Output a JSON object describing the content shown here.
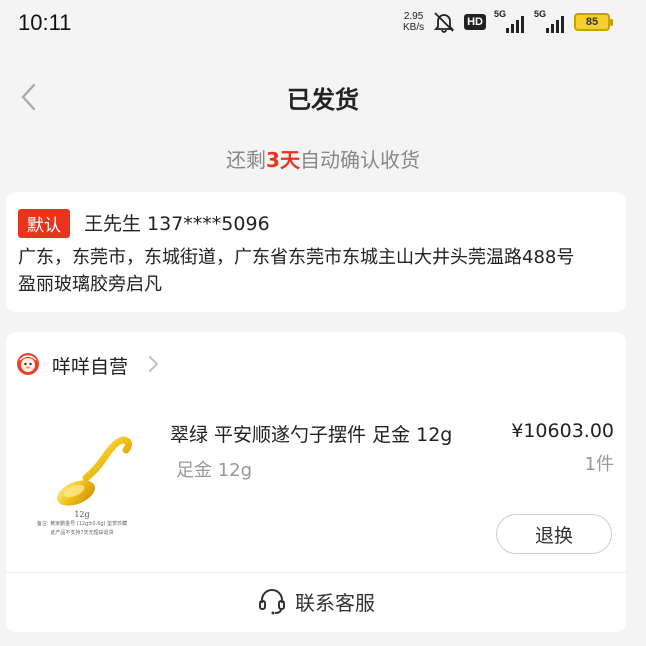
{
  "status_bar": {
    "time": "10:11",
    "speed_value": "2.95",
    "speed_unit": "KB/s",
    "hd_label": "HD",
    "sim1_label": "5G",
    "sim2_label": "5G",
    "battery_level": "85",
    "icons": [
      "bell-mute-icon",
      "hd-voice-icon",
      "signal-icon",
      "battery-icon"
    ]
  },
  "header": {
    "title": "已发货",
    "back_icon": "chevron-left-icon"
  },
  "status_line": {
    "prefix": "还剩",
    "days": "3天",
    "suffix": "自动确认收货",
    "accent_color": "#e8341c"
  },
  "address": {
    "badge": "默认",
    "name_phone": "王先生 137****5096",
    "line1": "广东，东莞市，东城街道，广东省东莞市东城主山大井头莞温路488号",
    "line2": "盈丽玻璃胶旁启凡"
  },
  "order": {
    "store_name": "咩咩自营",
    "store_icon": "store-logo-icon",
    "product": {
      "image_weight_label": "12g",
      "image_note_line1": "备注: 黄家鹏金号 (12g±0.6g) 鉴赏珍藏",
      "image_note_line2": "此产品不支持7天无理由退货",
      "name": "翠绿 平安顺遂勺子摆件 足金 12g",
      "spec": "足金 12g",
      "price": "¥10603.00",
      "quantity": "1件"
    },
    "return_button": "退换",
    "service_label": "联系客服",
    "service_icon": "headset-icon"
  }
}
